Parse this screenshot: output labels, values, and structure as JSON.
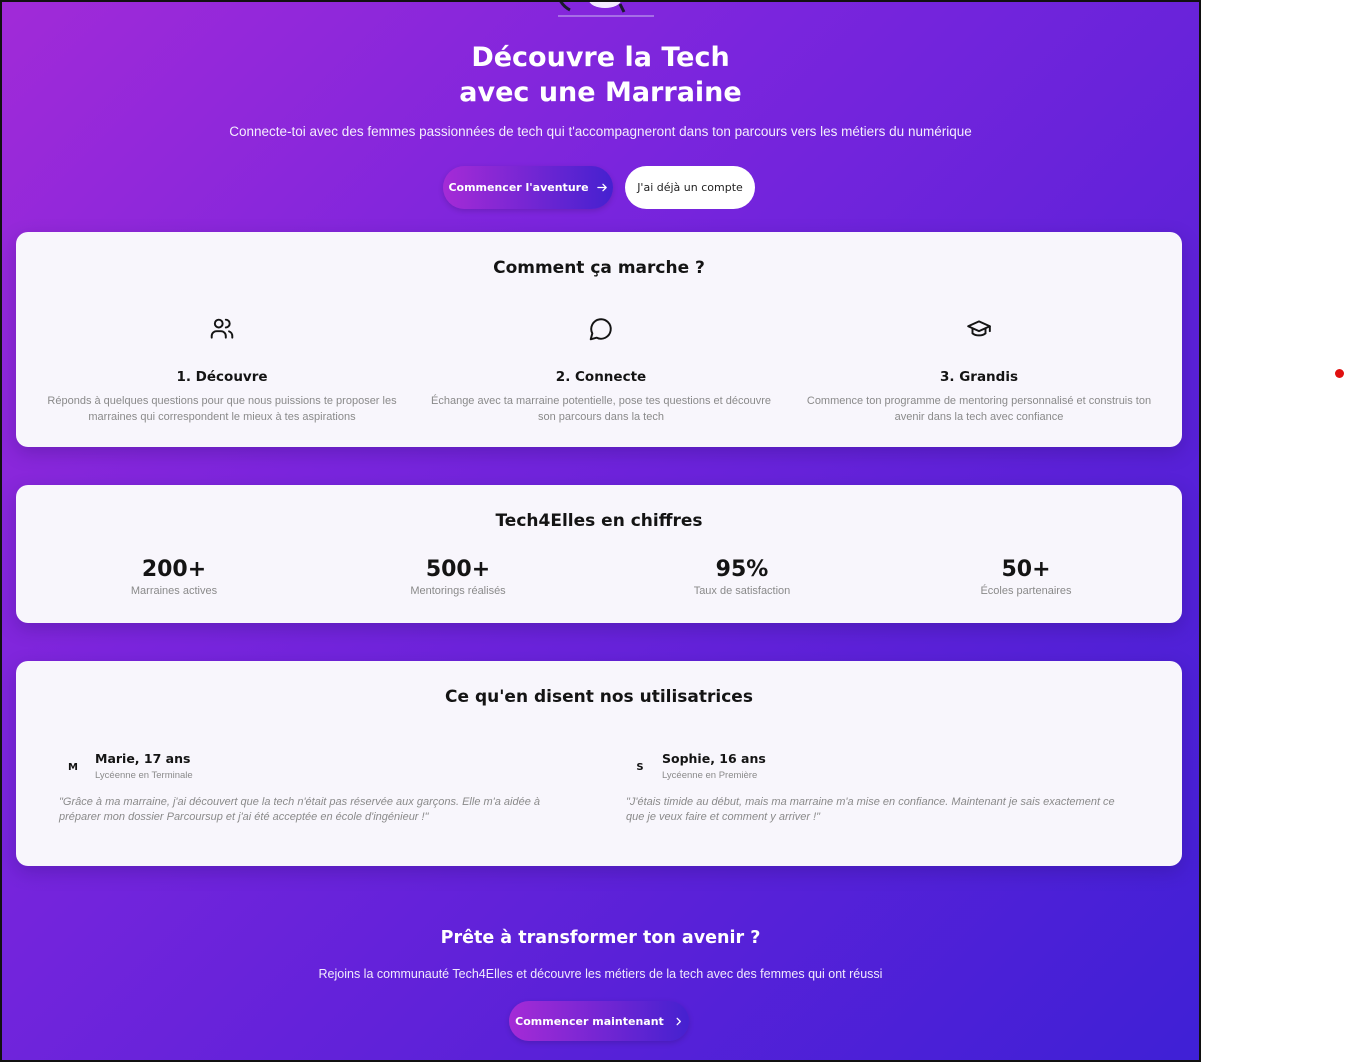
{
  "hero": {
    "title_line1": "Découvre la Tech",
    "title_line2": "avec une Marraine",
    "subtitle": "Connecte-toi avec des femmes passionnées de tech qui t'accompagneront dans ton parcours vers les métiers du numérique",
    "primary_button": "Commencer l'aventure",
    "secondary_button": "J'ai déjà un compte"
  },
  "how_it_works": {
    "title": "Comment ça marche ?",
    "steps": [
      {
        "icon": "users-icon",
        "title": "1. Découvre",
        "description": "Réponds à quelques questions pour que nous puissions te proposer les marraines qui correspondent le mieux à tes aspirations"
      },
      {
        "icon": "chat-bubble-icon",
        "title": "2. Connecte",
        "description": "Échange avec ta marraine potentielle, pose tes questions et découvre son parcours dans la tech"
      },
      {
        "icon": "graduation-cap-icon",
        "title": "3. Grandis",
        "description": "Commence ton programme de mentoring personnalisé et construis ton avenir dans la tech avec confiance"
      }
    ]
  },
  "stats": {
    "title": "Tech4Elles en chiffres",
    "items": [
      {
        "value": "200+",
        "label": "Marraines actives"
      },
      {
        "value": "500+",
        "label": "Mentorings réalisés"
      },
      {
        "value": "95%",
        "label": "Taux de satisfaction"
      },
      {
        "value": "50+",
        "label": "Écoles partenaires"
      }
    ]
  },
  "testimonials": {
    "title": "Ce qu'en disent nos utilisatrices",
    "items": [
      {
        "initial": "M",
        "name": "Marie, 17 ans",
        "role": "Lycéenne en Terminale",
        "quote": "\"Grâce à ma marraine, j'ai découvert que la tech n'était pas réservée aux garçons. Elle m'a aidée à préparer mon dossier Parcoursup et j'ai été acceptée en école d'ingénieur !\""
      },
      {
        "initial": "S",
        "name": "Sophie, 16 ans",
        "role": "Lycéenne en Première",
        "quote": "\"J'étais timide au début, mais ma marraine m'a mise en confiance. Maintenant je sais exactement ce que je veux faire et comment y arriver !\""
      }
    ]
  },
  "cta": {
    "title": "Prête à transformer ton avenir ?",
    "subtitle": "Rejoins la communauté Tech4Elles et découvre les métiers de la tech avec des femmes qui ont réussi",
    "button": "Commencer maintenant"
  },
  "colors": {
    "gradient_start": "#a12ad8",
    "gradient_end": "#3f20d6",
    "card_background": "#f8f6fc",
    "muted_text": "#8a8a8a"
  }
}
